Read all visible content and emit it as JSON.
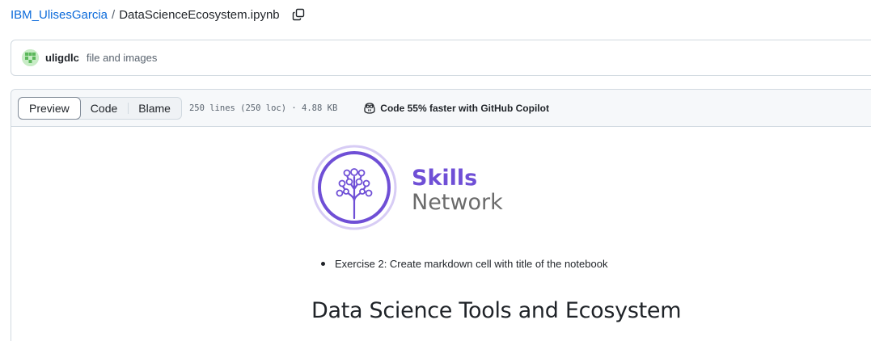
{
  "breadcrumb": {
    "repo": "IBM_UlisesGarcia",
    "separator": "/",
    "file": "DataScienceEcosystem.ipynb",
    "copy_icon": "copy-icon"
  },
  "commit": {
    "author": "uligdlc",
    "message": "file and images",
    "avatar_icon": "identicon-avatar"
  },
  "file_header": {
    "tabs": [
      {
        "label": "Preview",
        "selected": true
      },
      {
        "label": "Code",
        "selected": false
      },
      {
        "label": "Blame",
        "selected": false
      }
    ],
    "meta": "250 lines (250 loc) · 4.88 KB",
    "copilot_label": "Code 55% faster with GitHub Copilot",
    "copilot_icon": "copilot-icon"
  },
  "notebook": {
    "logo": {
      "word1": "Skills",
      "word2": "Network",
      "icon": "skills-network-tree-icon",
      "color_primary": "#6f4fd6",
      "color_secondary": "#6b6b6b"
    },
    "bullets": [
      "Exercise 2: Create markdown cell with title of the notebook"
    ],
    "heading": "Data Science Tools and Ecosystem"
  },
  "colors": {
    "link": "#0969da",
    "border": "#d1d9e0",
    "header_bg": "#f6f8fa",
    "muted_text": "#59636e"
  }
}
